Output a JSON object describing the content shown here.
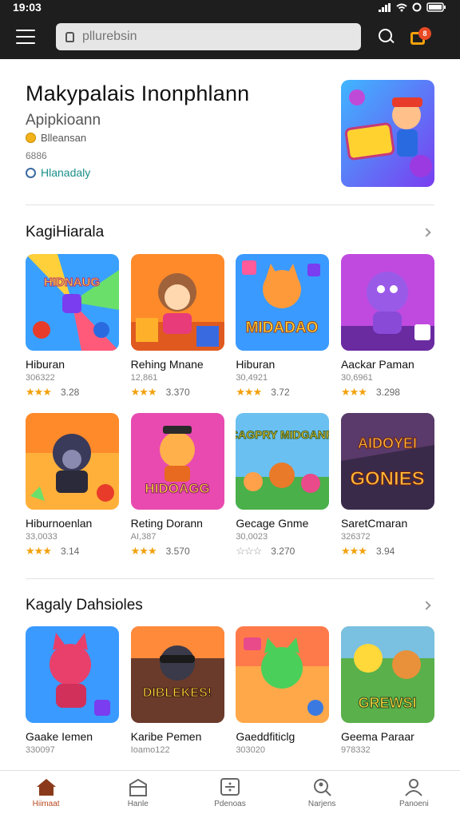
{
  "status": {
    "time": "19:03"
  },
  "search": {
    "placeholder": "pllurebsin"
  },
  "cart": {
    "badge": "8"
  },
  "hero": {
    "title": "Makypalais Inonphlann",
    "subtitle": "Apipkioann",
    "developer": "Blleansan",
    "count": "6886",
    "link": "Hlanadaly"
  },
  "sections": [
    {
      "title": "KagiHiarala",
      "rows": [
        [
          {
            "name": "Hiburan",
            "meta": "306322",
            "rating": "3.28",
            "stars": "★★★",
            "art": "puzzle"
          },
          {
            "name": "Rehing Mnane",
            "meta": "12,861",
            "rating": "3.370",
            "stars": "★★★",
            "art": "fox"
          },
          {
            "name": "Hiburan",
            "meta": "30,4921",
            "rating": "3.72",
            "stars": "★★★",
            "art": "cat"
          },
          {
            "name": "Aackar Paman",
            "meta": "30,6961",
            "rating": "3.298",
            "stars": "★★★",
            "art": "purple"
          }
        ],
        [
          {
            "name": "Hiburnoenlan",
            "meta": "33,0033",
            "rating": "3.14",
            "stars": "★★★",
            "art": "bear"
          },
          {
            "name": "Reting Dorann",
            "meta": "AI,387",
            "rating": "3.570",
            "stars": "★★★",
            "art": "dog"
          },
          {
            "name": "Gecage Gnme",
            "meta": "30,0023",
            "rating": "3.270",
            "stars": "☆☆☆",
            "art": "camp"
          },
          {
            "name": "SaretCmaran",
            "meta": "326372",
            "rating": "3.94",
            "stars": "★★★",
            "art": "gones"
          }
        ]
      ]
    },
    {
      "title": "Kagaly Dahsioles",
      "rows": [
        [
          {
            "name": "Gaake Iemen",
            "meta": "330097",
            "art": "pinkcat"
          },
          {
            "name": "Karibe Pemen",
            "meta": "Ioamo122",
            "art": "racer"
          },
          {
            "name": "Gaeddfiticlg",
            "meta": "303020",
            "art": "green"
          },
          {
            "name": "Geema Paraar",
            "meta": "978332",
            "art": "duo"
          }
        ]
      ]
    }
  ],
  "nav": [
    {
      "label": "Hiimaat",
      "icon": "home-icon"
    },
    {
      "label": "Hanle",
      "icon": "store-icon"
    },
    {
      "label": "Pdenoas",
      "icon": "apps-icon"
    },
    {
      "label": "Narjens",
      "icon": "search-user-icon"
    },
    {
      "label": "Panoeni",
      "icon": "profile-icon"
    }
  ],
  "colors": {
    "accent": "#f2a10c",
    "topbar": "#1e1e1e",
    "active_nav": "#b84a20"
  }
}
